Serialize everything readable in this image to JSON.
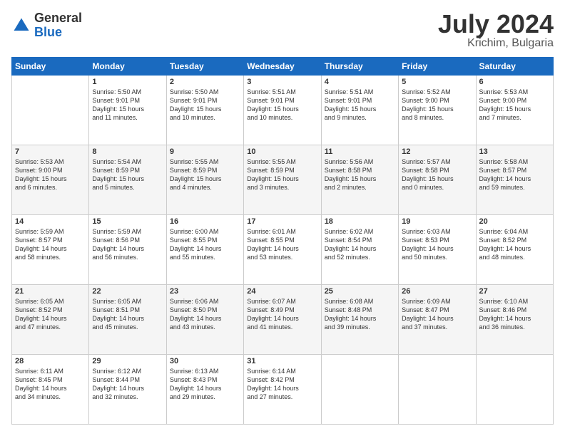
{
  "logo": {
    "general": "General",
    "blue": "Blue"
  },
  "title": "July 2024",
  "subtitle": "Krichim, Bulgaria",
  "days_of_week": [
    "Sunday",
    "Monday",
    "Tuesday",
    "Wednesday",
    "Thursday",
    "Friday",
    "Saturday"
  ],
  "weeks": [
    [
      {
        "day": "",
        "info": ""
      },
      {
        "day": "1",
        "info": "Sunrise: 5:50 AM\nSunset: 9:01 PM\nDaylight: 15 hours\nand 11 minutes."
      },
      {
        "day": "2",
        "info": "Sunrise: 5:50 AM\nSunset: 9:01 PM\nDaylight: 15 hours\nand 10 minutes."
      },
      {
        "day": "3",
        "info": "Sunrise: 5:51 AM\nSunset: 9:01 PM\nDaylight: 15 hours\nand 10 minutes."
      },
      {
        "day": "4",
        "info": "Sunrise: 5:51 AM\nSunset: 9:01 PM\nDaylight: 15 hours\nand 9 minutes."
      },
      {
        "day": "5",
        "info": "Sunrise: 5:52 AM\nSunset: 9:00 PM\nDaylight: 15 hours\nand 8 minutes."
      },
      {
        "day": "6",
        "info": "Sunrise: 5:53 AM\nSunset: 9:00 PM\nDaylight: 15 hours\nand 7 minutes."
      }
    ],
    [
      {
        "day": "7",
        "info": "Sunrise: 5:53 AM\nSunset: 9:00 PM\nDaylight: 15 hours\nand 6 minutes."
      },
      {
        "day": "8",
        "info": "Sunrise: 5:54 AM\nSunset: 8:59 PM\nDaylight: 15 hours\nand 5 minutes."
      },
      {
        "day": "9",
        "info": "Sunrise: 5:55 AM\nSunset: 8:59 PM\nDaylight: 15 hours\nand 4 minutes."
      },
      {
        "day": "10",
        "info": "Sunrise: 5:55 AM\nSunset: 8:59 PM\nDaylight: 15 hours\nand 3 minutes."
      },
      {
        "day": "11",
        "info": "Sunrise: 5:56 AM\nSunset: 8:58 PM\nDaylight: 15 hours\nand 2 minutes."
      },
      {
        "day": "12",
        "info": "Sunrise: 5:57 AM\nSunset: 8:58 PM\nDaylight: 15 hours\nand 0 minutes."
      },
      {
        "day": "13",
        "info": "Sunrise: 5:58 AM\nSunset: 8:57 PM\nDaylight: 14 hours\nand 59 minutes."
      }
    ],
    [
      {
        "day": "14",
        "info": "Sunrise: 5:59 AM\nSunset: 8:57 PM\nDaylight: 14 hours\nand 58 minutes."
      },
      {
        "day": "15",
        "info": "Sunrise: 5:59 AM\nSunset: 8:56 PM\nDaylight: 14 hours\nand 56 minutes."
      },
      {
        "day": "16",
        "info": "Sunrise: 6:00 AM\nSunset: 8:55 PM\nDaylight: 14 hours\nand 55 minutes."
      },
      {
        "day": "17",
        "info": "Sunrise: 6:01 AM\nSunset: 8:55 PM\nDaylight: 14 hours\nand 53 minutes."
      },
      {
        "day": "18",
        "info": "Sunrise: 6:02 AM\nSunset: 8:54 PM\nDaylight: 14 hours\nand 52 minutes."
      },
      {
        "day": "19",
        "info": "Sunrise: 6:03 AM\nSunset: 8:53 PM\nDaylight: 14 hours\nand 50 minutes."
      },
      {
        "day": "20",
        "info": "Sunrise: 6:04 AM\nSunset: 8:52 PM\nDaylight: 14 hours\nand 48 minutes."
      }
    ],
    [
      {
        "day": "21",
        "info": "Sunrise: 6:05 AM\nSunset: 8:52 PM\nDaylight: 14 hours\nand 47 minutes."
      },
      {
        "day": "22",
        "info": "Sunrise: 6:05 AM\nSunset: 8:51 PM\nDaylight: 14 hours\nand 45 minutes."
      },
      {
        "day": "23",
        "info": "Sunrise: 6:06 AM\nSunset: 8:50 PM\nDaylight: 14 hours\nand 43 minutes."
      },
      {
        "day": "24",
        "info": "Sunrise: 6:07 AM\nSunset: 8:49 PM\nDaylight: 14 hours\nand 41 minutes."
      },
      {
        "day": "25",
        "info": "Sunrise: 6:08 AM\nSunset: 8:48 PM\nDaylight: 14 hours\nand 39 minutes."
      },
      {
        "day": "26",
        "info": "Sunrise: 6:09 AM\nSunset: 8:47 PM\nDaylight: 14 hours\nand 37 minutes."
      },
      {
        "day": "27",
        "info": "Sunrise: 6:10 AM\nSunset: 8:46 PM\nDaylight: 14 hours\nand 36 minutes."
      }
    ],
    [
      {
        "day": "28",
        "info": "Sunrise: 6:11 AM\nSunset: 8:45 PM\nDaylight: 14 hours\nand 34 minutes."
      },
      {
        "day": "29",
        "info": "Sunrise: 6:12 AM\nSunset: 8:44 PM\nDaylight: 14 hours\nand 32 minutes."
      },
      {
        "day": "30",
        "info": "Sunrise: 6:13 AM\nSunset: 8:43 PM\nDaylight: 14 hours\nand 29 minutes."
      },
      {
        "day": "31",
        "info": "Sunrise: 6:14 AM\nSunset: 8:42 PM\nDaylight: 14 hours\nand 27 minutes."
      },
      {
        "day": "",
        "info": ""
      },
      {
        "day": "",
        "info": ""
      },
      {
        "day": "",
        "info": ""
      }
    ]
  ]
}
